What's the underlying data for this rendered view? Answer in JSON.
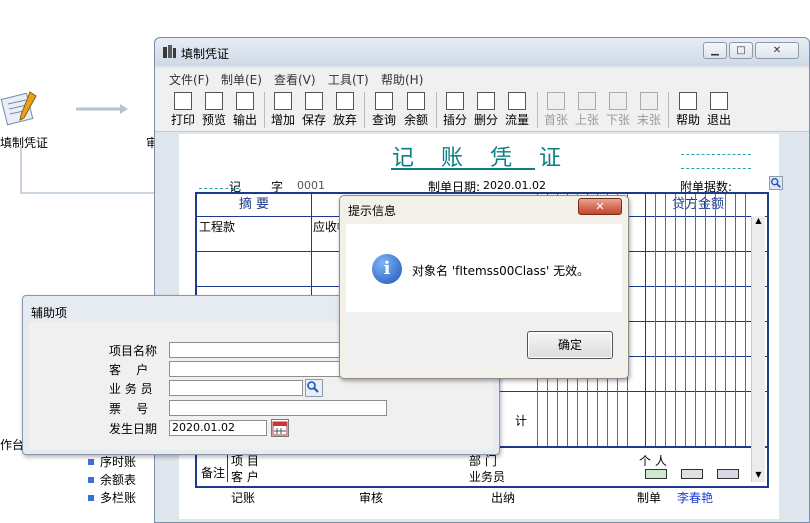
{
  "background": {
    "workflow_label": "填制凭证",
    "next_label_cut": "审",
    "workbench_label": "作台",
    "side_list": [
      "序时账",
      "余额表",
      "多栏账"
    ]
  },
  "window": {
    "title": "填制凭证",
    "menu": [
      "文件(F)",
      "制单(E)",
      "查看(V)",
      "工具(T)",
      "帮助(H)"
    ],
    "toolbar": [
      {
        "label": "打印",
        "icon": "printer-icon",
        "enabled": true
      },
      {
        "label": "预览",
        "icon": "preview-icon",
        "enabled": true
      },
      {
        "label": "输出",
        "icon": "export-icon",
        "enabled": true
      },
      {
        "label": "增加",
        "icon": "add-icon",
        "enabled": true
      },
      {
        "label": "保存",
        "icon": "save-icon",
        "enabled": true
      },
      {
        "label": "放弃",
        "icon": "undo-icon",
        "enabled": true
      },
      {
        "label": "查询",
        "icon": "binoculars-icon",
        "enabled": true
      },
      {
        "label": "余额",
        "icon": "balance-chart-icon",
        "enabled": true
      },
      {
        "label": "插分",
        "icon": "insert-row-icon",
        "enabled": true
      },
      {
        "label": "删分",
        "icon": "delete-row-icon",
        "enabled": true
      },
      {
        "label": "流量",
        "icon": "flow-icon",
        "enabled": true
      },
      {
        "label": "首张",
        "icon": "first-icon",
        "enabled": false
      },
      {
        "label": "上张",
        "icon": "prev-icon",
        "enabled": false
      },
      {
        "label": "下张",
        "icon": "next-icon",
        "enabled": false
      },
      {
        "label": "末张",
        "icon": "last-icon",
        "enabled": false
      },
      {
        "label": "帮助",
        "icon": "help-icon",
        "enabled": true
      },
      {
        "label": "退出",
        "icon": "exit-icon",
        "enabled": true
      }
    ]
  },
  "voucher": {
    "title": "记 账 凭 证",
    "type_label": "记",
    "zi_label": "字",
    "number": "0001",
    "date_label": "制单日期:",
    "date": "2020.01.02",
    "attach_label": "附单据数:",
    "col_summary": "摘 要",
    "col_credit": "贷方金额",
    "row1_summary": "工程款",
    "row1_account": "应收帐",
    "total_label": "计",
    "memo_label": "备注",
    "project_label": "项 目",
    "customer_label": "客 户",
    "dept_label": "部 门",
    "individual_label": "个 人",
    "salesman_label": "业务员",
    "bottom": {
      "bookkeep": "记账",
      "review": "审核",
      "cashier": "出纳",
      "maker_label": "制单",
      "maker": "李春艳"
    }
  },
  "message_dialog": {
    "title": "提示信息",
    "message": "对象名 'fItemss00Class' 无效。",
    "ok": "确定"
  },
  "aux_dialog": {
    "title": "辅助项",
    "fields": [
      {
        "label": "项目名称",
        "value": ""
      },
      {
        "label": "客    户",
        "value": ""
      },
      {
        "label": "业 务 员",
        "value": ""
      },
      {
        "label": "票    号",
        "value": ""
      },
      {
        "label": "发生日期",
        "value": "2020.01.02"
      }
    ]
  },
  "colors": {
    "voucher_title": "#0a7f84",
    "grid_blue": "#1c3b8a",
    "maker_name": "#1c3fd0"
  }
}
